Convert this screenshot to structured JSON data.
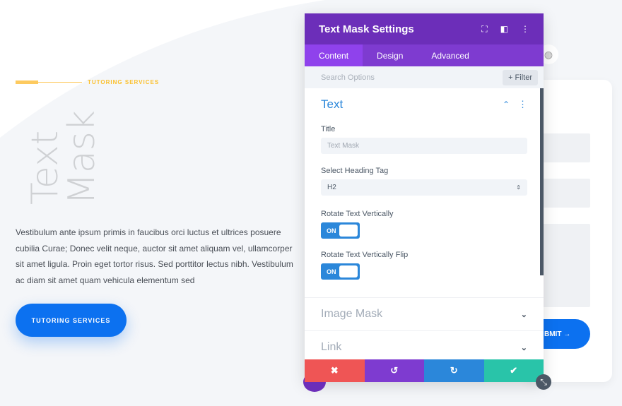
{
  "page": {
    "eyebrow": "TUTORING SERVICES",
    "mask_line1": "Text",
    "mask_line2": "Mask",
    "paragraph": "Vestibulum ante ipsum primis in faucibus orci luctus et ultrices posuere cubilia Curae; Donec velit neque, auctor sit amet aliquam vel, ullamcorper sit amet ligula. Proin eget tortor risus. Sed porttitor lectus nibh. Vestibulum ac diam sit amet quam vehicula elementum sed",
    "cta": "TUTORING SERVICES",
    "submit": "BMIT →"
  },
  "modal": {
    "title": "Text Mask Settings",
    "tabs": [
      "Content",
      "Design",
      "Advanced"
    ],
    "active_tab": "Content",
    "search_placeholder": "Search Options",
    "filter": "+ Filter",
    "section": {
      "title": "Text",
      "title_label": "Title",
      "title_placeholder": "Text Mask",
      "heading_label": "Select Heading Tag",
      "heading_value": "H2",
      "rotate_label": "Rotate Text Vertically",
      "rotate_value": "ON",
      "flip_label": "Rotate Text Vertically Flip",
      "flip_value": "ON"
    },
    "collapsed": [
      "Image Mask",
      "Link"
    ]
  },
  "colors": {
    "header": "#6c2eb9",
    "tabs": "#7e3bd0",
    "accent": "#2b87da",
    "cancel": "#ef5555",
    "undo": "#7e3bd0",
    "redo": "#2b87da",
    "save": "#29c4a9",
    "cta": "#0c71f0"
  }
}
